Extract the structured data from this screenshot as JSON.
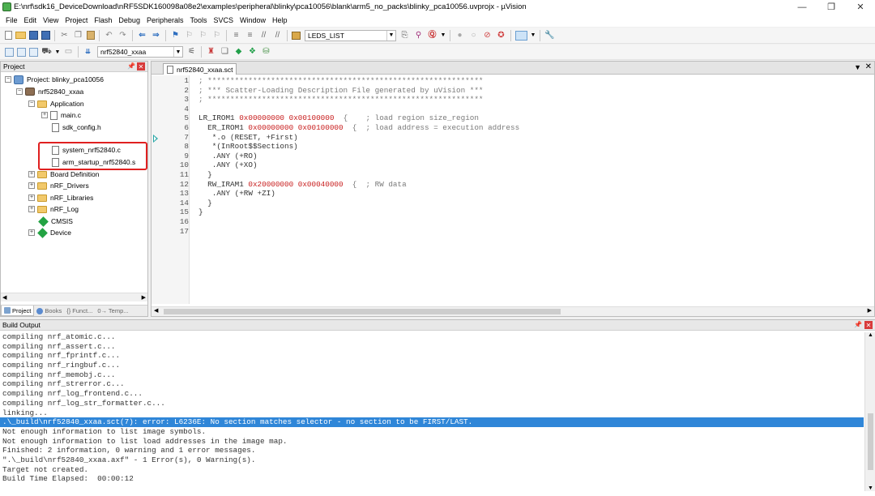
{
  "window": {
    "title": "E:\\nrf\\sdk16_DeviceDownload\\nRF5SDK160098a08e2\\examples\\peripheral\\blinky\\pca10056\\blank\\arm5_no_packs\\blinky_pca10056.uvprojx - µVision",
    "minimize": "—",
    "maximize": "❐",
    "close": "✕"
  },
  "menu": [
    "File",
    "Edit",
    "View",
    "Project",
    "Flash",
    "Debug",
    "Peripherals",
    "Tools",
    "SVCS",
    "Window",
    "Help"
  ],
  "toolbar": {
    "find_combo": "LEDS_LIST",
    "target_combo": "nrf52840_xxaa"
  },
  "project_panel": {
    "title": "Project",
    "tree": {
      "root": "Project: blinky_pca10056",
      "target": "nrf52840_xxaa",
      "application": "Application",
      "files": [
        "main.c",
        "sdk_config.h",
        "system_nrf52840.c",
        "arm_startup_nrf52840.s"
      ],
      "groups": [
        "Board Definition",
        "nRF_Drivers",
        "nRF_Libraries",
        "nRF_Log",
        "CMSIS",
        "Device"
      ]
    },
    "tabs": [
      "Project",
      "Books",
      "{} Funct...",
      "0→ Temp..."
    ]
  },
  "editor": {
    "tab": "nrf52840_xxaa.sct",
    "lines": [
      {
        "n": "1",
        "text": "; *************************************************************"
      },
      {
        "n": "2",
        "text": "; *** Scatter-Loading Description File generated by uVision ***"
      },
      {
        "n": "3",
        "text": "; *************************************************************"
      },
      {
        "n": "4",
        "text": ""
      },
      {
        "n": "5",
        "a": "LR_IROM1 ",
        "h1": "0x00000000",
        "b": " ",
        "h2": "0x00100000",
        "c": "  {    ; load region size_region"
      },
      {
        "n": "6",
        "a": "  ER_IROM1 ",
        "h1": "0x00000000",
        "b": " ",
        "h2": "0x00100000",
        "c": "  {  ; load address = execution address"
      },
      {
        "n": "7",
        "text": "   *.o (RESET, +First)"
      },
      {
        "n": "8",
        "text": "   *(InRoot$$Sections)"
      },
      {
        "n": "9",
        "text": "   .ANY (+RO)"
      },
      {
        "n": "10",
        "text": "   .ANY (+XO)"
      },
      {
        "n": "11",
        "text": "  }"
      },
      {
        "n": "12",
        "a": "  RW_IRAM1 ",
        "h1": "0x20000000",
        "b": " ",
        "h2": "0x00040000",
        "c": "  {  ; RW data"
      },
      {
        "n": "13",
        "text": "   .ANY (+RW +ZI)"
      },
      {
        "n": "14",
        "text": "  }"
      },
      {
        "n": "15",
        "text": "}"
      },
      {
        "n": "16",
        "text": ""
      },
      {
        "n": "17",
        "text": ""
      }
    ]
  },
  "build_output": {
    "title": "Build Output",
    "lines": [
      "compiling nrf_atomic.c...",
      "compiling nrf_assert.c...",
      "compiling nrf_fprintf.c...",
      "compiling nrf_ringbuf.c...",
      "compiling nrf_memobj.c...",
      "compiling nrf_strerror.c...",
      "compiling nrf_log_frontend.c...",
      "compiling nrf_log_str_formatter.c...",
      "linking...",
      ".\\_build\\nrf52840_xxaa.sct(7): error: L6236E: No section matches selector - no section to be FIRST/LAST.",
      "Not enough information to list image symbols.",
      "Not enough information to list load addresses in the image map.",
      "Finished: 2 information, 0 warning and 1 error messages.",
      "\".\\_build\\nrf52840_xxaa.axf\" - 1 Error(s), 0 Warning(s).",
      "Target not created.",
      "Build Time Elapsed:  00:00:12"
    ],
    "selected_index": 9
  }
}
